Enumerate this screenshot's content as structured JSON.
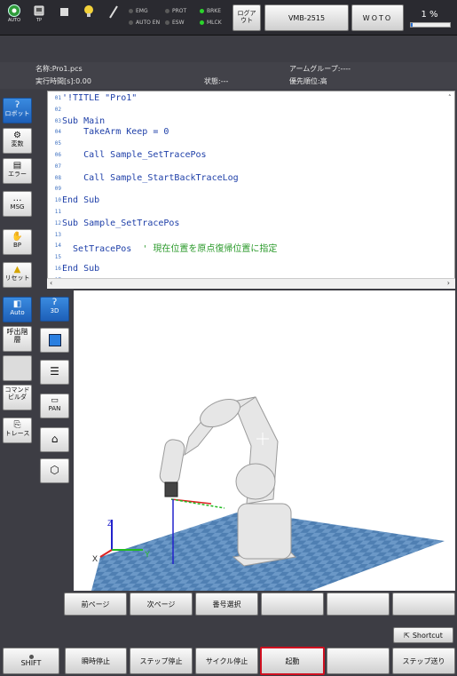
{
  "topbar": {
    "auto_label": "AUTO",
    "tp_label": "TP",
    "signals": [
      {
        "label": "EMG",
        "on": false
      },
      {
        "label": "AUTO EN",
        "on": false
      },
      {
        "label": "PROT",
        "on": false
      },
      {
        "label": "ESW",
        "on": false
      },
      {
        "label": "BRKE",
        "on": true
      },
      {
        "label": "MLCK",
        "on": true
      }
    ],
    "logout_label": "ログアウト",
    "robot_model": "VMB-2515",
    "tool_label": "WOTO",
    "speed_text": "1 %",
    "speed_fraction": 0.01
  },
  "info": {
    "name_label": "名称:Pro1.pcs",
    "arm_group": "アームグループ:----",
    "exec_time": "実行時間[s]:0.00",
    "state": "状態:---",
    "priority": "優先順位:高"
  },
  "left_menu": {
    "robot": "ロボット",
    "variables": "変数",
    "error": "エラー",
    "msg": "MSG",
    "bp": "BP",
    "reset": "リセット",
    "auto": "Auto",
    "call_hierarchy": "呼出階層",
    "blank": "",
    "command_builder": "コマンドビルダ",
    "trace": "トレース"
  },
  "editor": {
    "lines": [
      {
        "n": "01",
        "code": "'!TITLE \"Pro1\"",
        "comment": ""
      },
      {
        "n": "02",
        "code": "",
        "comment": ""
      },
      {
        "n": "03",
        "code": "Sub Main",
        "comment": ""
      },
      {
        "n": "04",
        "code": "    TakeArm Keep = 0",
        "comment": ""
      },
      {
        "n": "05",
        "code": "",
        "comment": ""
      },
      {
        "n": "06",
        "code": "    Call Sample_SetTracePos",
        "comment": ""
      },
      {
        "n": "07",
        "code": "",
        "comment": ""
      },
      {
        "n": "08",
        "code": "    Call Sample_StartBackTraceLog",
        "comment": ""
      },
      {
        "n": "09",
        "code": "",
        "comment": ""
      },
      {
        "n": "10",
        "code": "End Sub",
        "comment": ""
      },
      {
        "n": "11",
        "code": "",
        "comment": ""
      },
      {
        "n": "12",
        "code": "Sub Sample_SetTracePos",
        "comment": ""
      },
      {
        "n": "13",
        "code": "",
        "comment": ""
      },
      {
        "n": "14",
        "code": "  SetTracePos  ",
        "comment": "' 現在位置を原点復帰位置に指定"
      },
      {
        "n": "15",
        "code": "",
        "comment": ""
      },
      {
        "n": "16",
        "code": "End Sub",
        "comment": ""
      },
      {
        "n": "17",
        "code": "",
        "comment": ""
      }
    ]
  },
  "viewer": {
    "btn_3d": "3D",
    "btn_pan": "PAN",
    "axis_x": "X",
    "axis_y": "Y",
    "axis_z": "Z"
  },
  "page_buttons": {
    "prev": "前ページ",
    "next": "次ページ",
    "number_select": "番号選択"
  },
  "shortcut": "Shortcut",
  "function_buttons": {
    "shift": "SHIFT",
    "instant_stop": "瞬時停止",
    "step_stop": "ステップ停止",
    "cycle_stop": "サイクル停止",
    "start": "起動",
    "step_forward": "ステップ送り"
  },
  "colors": {
    "accent_blue": "#1d5fb8",
    "highlight_red": "#d01020",
    "signal_on": "#2bd42b",
    "code_blue": "#1e3fa8",
    "comment_green": "#2b9a2b"
  }
}
